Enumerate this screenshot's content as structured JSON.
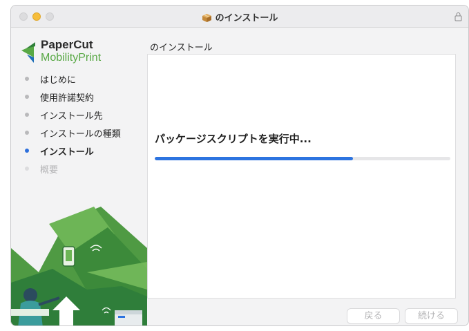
{
  "window": {
    "title": "のインストール"
  },
  "logo": {
    "line1": "PaperCut",
    "line2": "MobilityPrint"
  },
  "sidebar": {
    "steps": [
      {
        "label": "はじめに",
        "state": "done"
      },
      {
        "label": "使用許諾契約",
        "state": "done"
      },
      {
        "label": "インストール先",
        "state": "done"
      },
      {
        "label": "インストールの種類",
        "state": "done"
      },
      {
        "label": "インストール",
        "state": "active"
      },
      {
        "label": "概要",
        "state": "pending"
      }
    ]
  },
  "main": {
    "section_title": "のインストール",
    "status": "パッケージスクリプトを実行中...",
    "progress": 0.67
  },
  "buttons": {
    "back_label": "戻る",
    "continue_label": "続ける"
  },
  "colors": {
    "accent": "#2d74e0",
    "brand_green": "#58a845",
    "title_yellow": "#f6bd3b"
  },
  "icons": [
    "package-icon",
    "lock-icon",
    "papercut-logo"
  ]
}
